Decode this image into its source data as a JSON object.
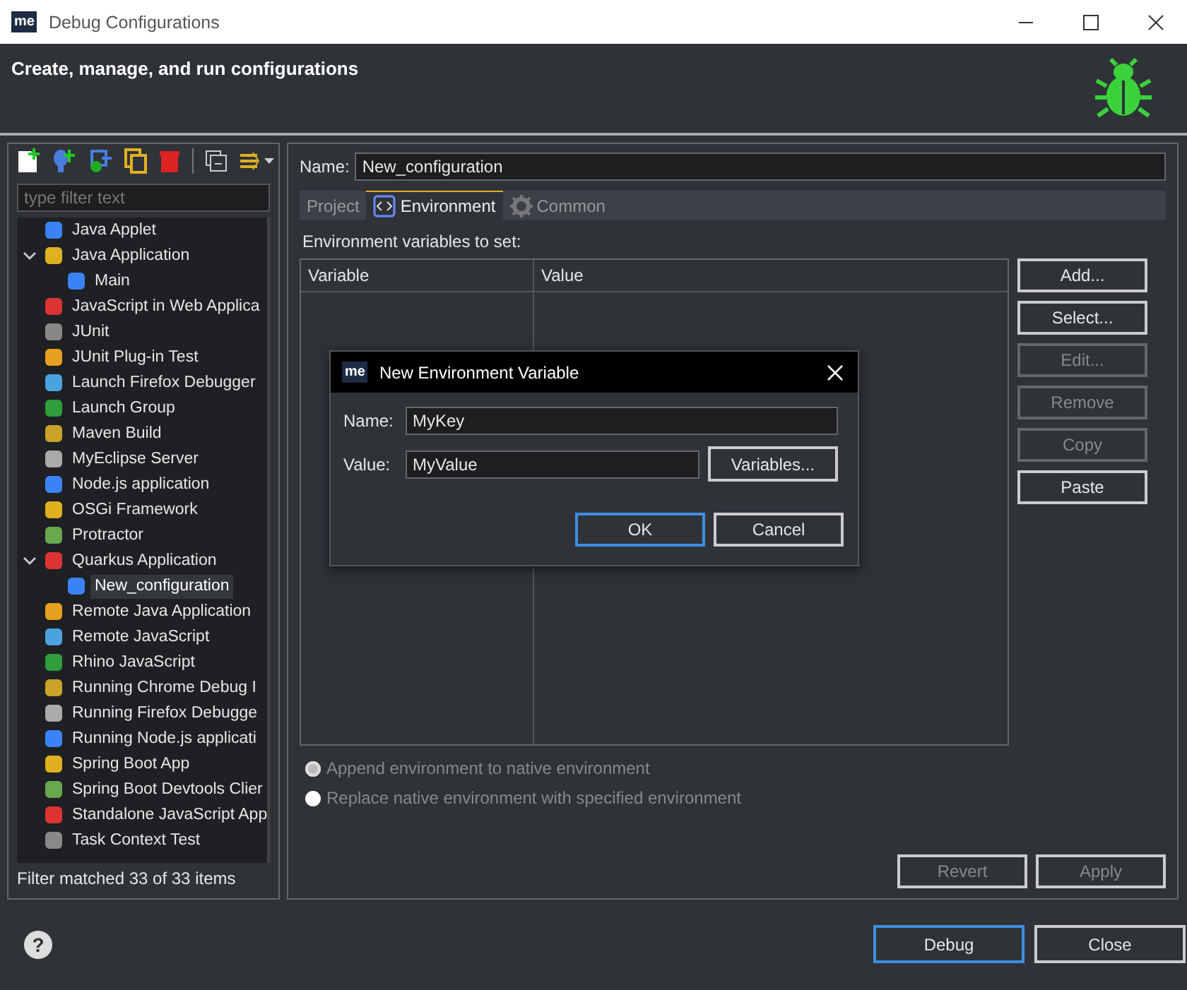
{
  "window": {
    "logo": "me",
    "title": "Debug Configurations"
  },
  "header": {
    "title": "Create, manage, and run configurations"
  },
  "sidebar": {
    "filter": {
      "placeholder": "type filter text"
    },
    "items": [
      {
        "label": "Java Applet",
        "selected": false
      },
      {
        "label": "Java Application",
        "selected": false,
        "expanded": true,
        "children": [
          {
            "label": "Main",
            "selected": false
          }
        ]
      },
      {
        "label": "JavaScript in Web Applica",
        "selected": false
      },
      {
        "label": "JUnit",
        "selected": false
      },
      {
        "label": "JUnit Plug-in Test",
        "selected": false
      },
      {
        "label": "Launch Firefox Debugger",
        "selected": false
      },
      {
        "label": "Launch Group",
        "selected": false
      },
      {
        "label": "Maven Build",
        "selected": false
      },
      {
        "label": "MyEclipse Server",
        "selected": false
      },
      {
        "label": "Node.js application",
        "selected": false
      },
      {
        "label": "OSGi Framework",
        "selected": false
      },
      {
        "label": "Protractor",
        "selected": false
      },
      {
        "label": "Quarkus Application",
        "selected": false,
        "expanded": true,
        "children": [
          {
            "label": "New_configuration",
            "selected": true
          }
        ]
      },
      {
        "label": "Remote Java Application",
        "selected": false
      },
      {
        "label": "Remote JavaScript",
        "selected": false
      },
      {
        "label": "Rhino JavaScript",
        "selected": false
      },
      {
        "label": "Running Chrome Debug I",
        "selected": false
      },
      {
        "label": "Running Firefox Debugge",
        "selected": false
      },
      {
        "label": "Running Node.js applicati",
        "selected": false
      },
      {
        "label": "Spring Boot App",
        "selected": false
      },
      {
        "label": "Spring Boot Devtools Clier",
        "selected": false
      },
      {
        "label": "Standalone JavaScript App",
        "selected": false
      },
      {
        "label": "Task Context Test",
        "selected": false
      }
    ],
    "status": "Filter matched 33 of 33 items"
  },
  "editor": {
    "name_label": "Name:",
    "name_value": "New_configuration",
    "tabs": [
      {
        "label": "Project",
        "selected": false
      },
      {
        "label": "Environment",
        "selected": true
      },
      {
        "label": "Common",
        "selected": false
      }
    ],
    "section_label": "Environment variables to set:",
    "table": {
      "columns": [
        "Variable",
        "Value"
      ]
    },
    "side_buttons": [
      {
        "label": "Add...",
        "disabled": false
      },
      {
        "label": "Select...",
        "disabled": false
      },
      {
        "label": "Edit...",
        "disabled": true
      },
      {
        "label": "Remove",
        "disabled": true
      },
      {
        "label": "Copy",
        "disabled": true
      },
      {
        "label": "Paste",
        "disabled": false
      }
    ],
    "radios": [
      {
        "label": "Append environment to native environment",
        "selected": true,
        "disabled": true
      },
      {
        "label": "Replace native environment with specified environment",
        "selected": false,
        "disabled": true
      }
    ],
    "buttons": [
      {
        "label": "Revert",
        "disabled": true
      },
      {
        "label": "Apply",
        "disabled": true
      }
    ]
  },
  "footer": {
    "help": "?",
    "buttons": [
      {
        "label": "Debug",
        "default": true
      },
      {
        "label": "Close",
        "default": false
      }
    ]
  },
  "dialog": {
    "logo": "me",
    "title": "New Environment Variable",
    "fields": [
      {
        "label": "Name:",
        "value": "MyKey"
      },
      {
        "label": "Value:",
        "value": "MyValue"
      }
    ],
    "variables_button": "Variables...",
    "buttons": [
      {
        "label": "OK",
        "default": true
      },
      {
        "label": "Cancel",
        "default": false
      }
    ]
  }
}
